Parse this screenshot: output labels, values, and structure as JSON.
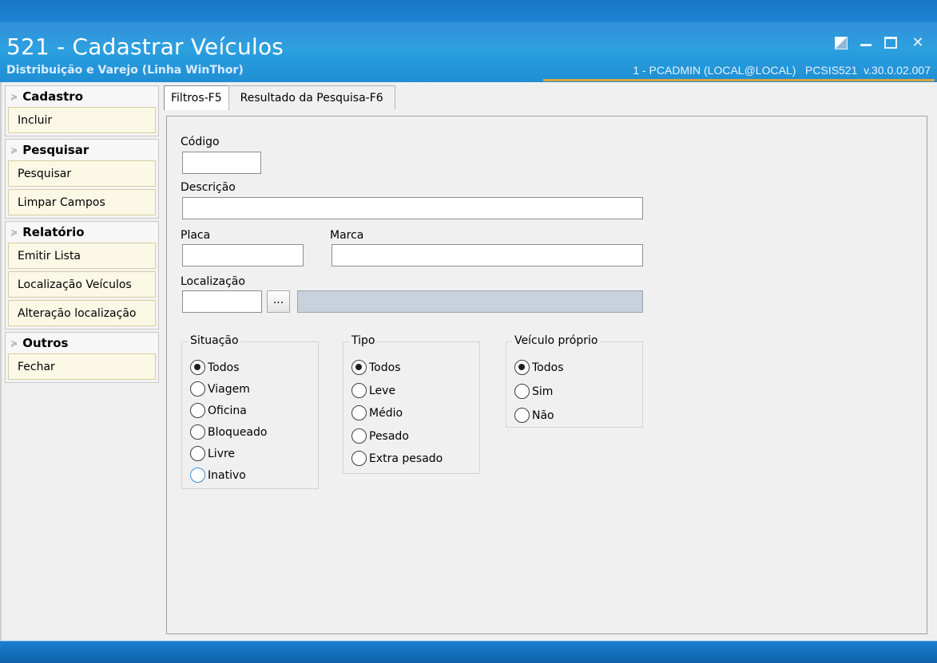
{
  "window": {
    "title": "521 - Cadastrar Veículos",
    "subtitle": "Distribuição e Varejo (Linha WinThor)",
    "user_info": "1 - PCADMIN (LOCAL@LOCAL)   PCSIS521  v.30.0.02.007"
  },
  "sidebar": {
    "groups": [
      {
        "title": "Cadastro",
        "items": [
          "Incluir"
        ]
      },
      {
        "title": "Pesquisar",
        "items": [
          "Pesquisar",
          "Limpar Campos"
        ]
      },
      {
        "title": "Relatório",
        "items": [
          "Emitir Lista",
          "Localização Veículos",
          "Alteração localização"
        ]
      },
      {
        "title": "Outros",
        "items": [
          "Fechar"
        ]
      }
    ]
  },
  "tabs": [
    {
      "label": "Filtros-F5",
      "active": true
    },
    {
      "label": "Resultado da Pesquisa-F6",
      "active": false
    }
  ],
  "form": {
    "codigo_label": "Código",
    "codigo_value": "",
    "descricao_label": "Descrição",
    "descricao_value": "",
    "placa_label": "Placa",
    "placa_value": "",
    "marca_label": "Marca",
    "marca_value": "",
    "localizacao_label": "Localização",
    "localizacao_value": "",
    "localizacao_button": "...",
    "localizacao_desc": ""
  },
  "situacao": {
    "title": "Situação",
    "options": [
      "Todos",
      "Viagem",
      "Oficina",
      "Bloqueado",
      "Livre",
      "Inativo"
    ],
    "selected": "Todos"
  },
  "tipo": {
    "title": "Tipo",
    "options": [
      "Todos",
      "Leve",
      "Médio",
      "Pesado",
      "Extra pesado"
    ],
    "selected": "Todos"
  },
  "veiculo_proprio": {
    "title": "Veículo próprio",
    "options": [
      "Todos",
      "Sim",
      "Não"
    ],
    "selected": "Todos"
  }
}
